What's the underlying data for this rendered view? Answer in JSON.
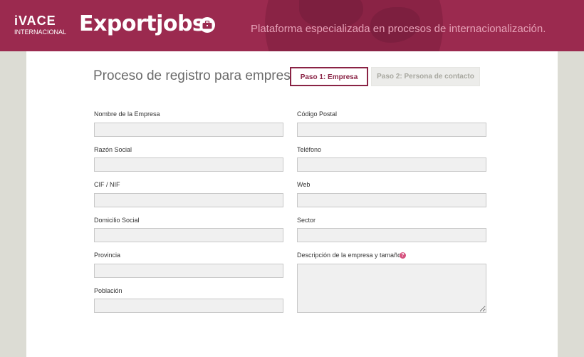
{
  "header": {
    "logo_top": "iVACE",
    "logo_bottom": "INTERNACIONAL",
    "brand": "Exportjobs",
    "brand_icon": "briefcase-icon",
    "tagline": "Plataforma especializada en procesos de internacionalización.",
    "background_color": "#9b2a4f"
  },
  "form": {
    "title": "Proceso de registro para empresas",
    "steps": [
      {
        "label": "Paso 1: Empresa",
        "active": true
      },
      {
        "label": "Paso 2: Persona de contacto",
        "active": false
      }
    ],
    "left_fields": [
      {
        "label": "Nombre de la Empresa",
        "value": ""
      },
      {
        "label": "Razón Social",
        "value": ""
      },
      {
        "label": "CIF / NIF",
        "value": ""
      },
      {
        "label": "Domicilio Social",
        "value": ""
      },
      {
        "label": "Provincia",
        "value": ""
      },
      {
        "label": "Población",
        "value": ""
      }
    ],
    "right_fields": [
      {
        "label": "Código Postal",
        "value": ""
      },
      {
        "label": "Teléfono",
        "value": ""
      },
      {
        "label": "Web",
        "value": ""
      },
      {
        "label": "Sector",
        "value": ""
      },
      {
        "label": "Descripción de la empresa y tamaño",
        "value": "",
        "help_icon": "help-icon",
        "help_glyph": "?"
      }
    ],
    "accent_color": "#8a2345"
  }
}
